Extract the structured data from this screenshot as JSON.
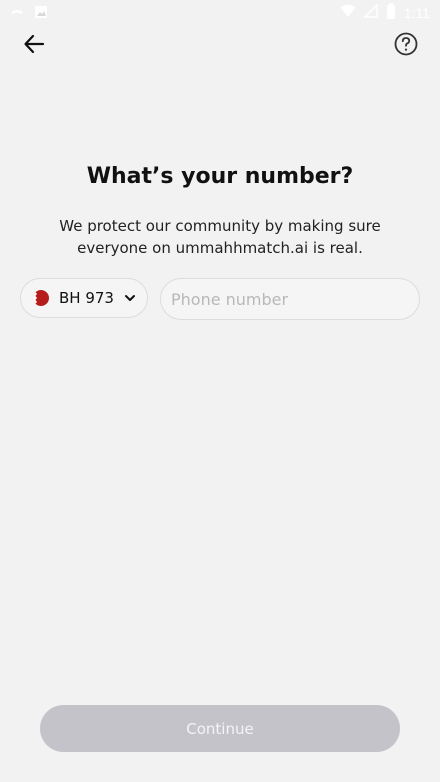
{
  "status_bar": {
    "time": "1:11",
    "icons": [
      "notification-icon",
      "image-icon",
      "wifi-icon",
      "signal-icon",
      "battery-icon"
    ]
  },
  "header": {
    "back_icon": "arrow-left-icon",
    "help_icon": "help-circle-icon"
  },
  "main": {
    "title": "What’s your number?",
    "subtitle": "We protect our community by making sure everyone on ummahhmatch.ai is real.",
    "country": {
      "flag": "bahrain-flag-icon",
      "label": "BH 973"
    },
    "phone": {
      "value": "",
      "placeholder": "Phone number"
    }
  },
  "footer": {
    "continue_label": "Continue"
  }
}
